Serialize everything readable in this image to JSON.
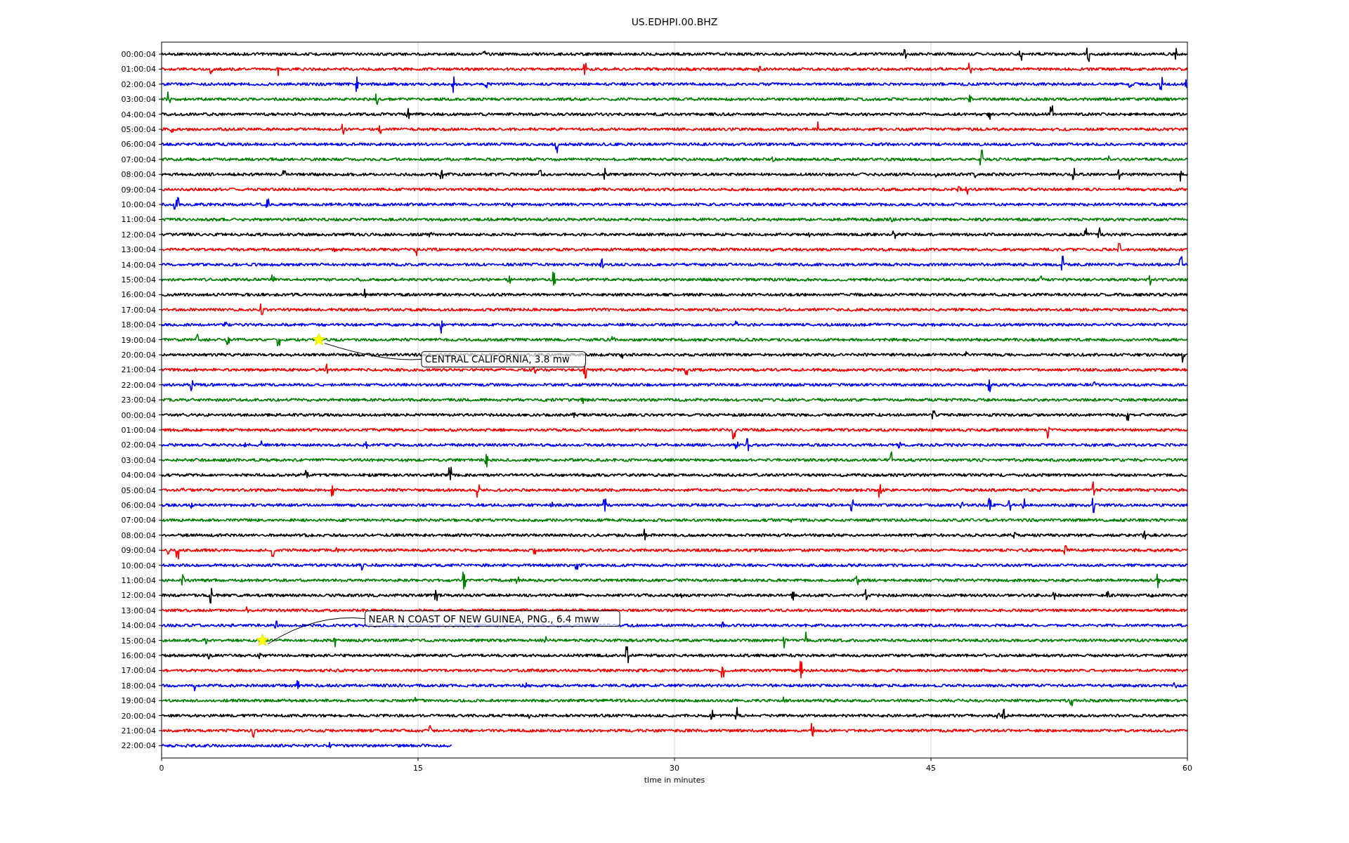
{
  "title": "US.EDHPI.00.BHZ",
  "traces": [
    {
      "label": "00:00:04",
      "color": "#000000",
      "level": 1
    },
    {
      "label": "01:00:04",
      "color": "#ff0000",
      "level": 1
    },
    {
      "label": "02:00:04",
      "color": "#0000ff",
      "level": 1
    },
    {
      "label": "03:00:04",
      "color": "#008000",
      "level": 1
    },
    {
      "label": "04:00:04",
      "color": "#000000",
      "level": 1
    },
    {
      "label": "05:00:04",
      "color": "#ff0000",
      "level": 1
    },
    {
      "label": "06:00:04",
      "color": "#0000ff",
      "level": 1
    },
    {
      "label": "07:00:04",
      "color": "#008000",
      "level": 1
    },
    {
      "label": "08:00:04",
      "color": "#000000",
      "level": 1
    },
    {
      "label": "09:00:04",
      "color": "#ff0000",
      "level": 1
    },
    {
      "label": "10:00:04",
      "color": "#0000ff",
      "level": 1
    },
    {
      "label": "11:00:04",
      "color": "#008000",
      "level": 1
    },
    {
      "label": "12:00:04",
      "color": "#000000",
      "level": 1
    },
    {
      "label": "13:00:04",
      "color": "#ff0000",
      "level": 1
    },
    {
      "label": "14:00:04",
      "color": "#0000ff",
      "level": 1
    },
    {
      "label": "15:00:04",
      "color": "#008000",
      "level": 1
    },
    {
      "label": "16:00:04",
      "color": "#000000",
      "level": 1
    },
    {
      "label": "17:00:04",
      "color": "#ff0000",
      "level": 1
    },
    {
      "label": "18:00:04",
      "color": "#0000ff",
      "level": 1
    },
    {
      "label": "19:00:04",
      "color": "#008000",
      "level": 1
    },
    {
      "label": "20:00:04",
      "color": "#000000",
      "level": 1
    },
    {
      "label": "21:00:04",
      "color": "#ff0000",
      "level": 1
    },
    {
      "label": "22:00:04",
      "color": "#0000ff",
      "level": 1
    },
    {
      "label": "23:00:04",
      "color": "#008000",
      "level": 1
    },
    {
      "label": "00:00:04",
      "color": "#000000",
      "level": 1
    },
    {
      "label": "01:00:04",
      "color": "#ff0000",
      "level": 1
    },
    {
      "label": "02:00:04",
      "color": "#0000ff",
      "level": 1
    },
    {
      "label": "03:00:04",
      "color": "#008000",
      "level": 1
    },
    {
      "label": "04:00:04",
      "color": "#000000",
      "level": 1
    },
    {
      "label": "05:00:04",
      "color": "#ff0000",
      "level": 1
    },
    {
      "label": "06:00:04",
      "color": "#0000ff",
      "level": 1
    },
    {
      "label": "07:00:04",
      "color": "#008000",
      "level": 1
    },
    {
      "label": "08:00:04",
      "color": "#000000",
      "level": 1
    },
    {
      "label": "09:00:04",
      "color": "#ff0000",
      "level": 1
    },
    {
      "label": "10:00:04",
      "color": "#0000ff",
      "level": 1
    },
    {
      "label": "11:00:04",
      "color": "#008000",
      "level": 1
    },
    {
      "label": "12:00:04",
      "color": "#000000",
      "level": 1
    },
    {
      "label": "13:00:04",
      "color": "#ff0000",
      "level": 1
    },
    {
      "label": "14:00:04",
      "color": "#0000ff",
      "level": 1
    },
    {
      "label": "15:00:04",
      "color": "#008000",
      "level": 1
    },
    {
      "label": "16:00:04",
      "color": "#000000",
      "level": 1
    },
    {
      "label": "17:00:04",
      "color": "#ff0000",
      "level": 1
    },
    {
      "label": "18:00:04",
      "color": "#0000ff",
      "level": 1
    },
    {
      "label": "19:00:04",
      "color": "#008000",
      "level": 1
    },
    {
      "label": "20:00:04",
      "color": "#000000",
      "level": 1
    },
    {
      "label": "21:00:04",
      "color": "#ff0000",
      "level": 1
    },
    {
      "label": "22:00:04",
      "color": "#0000ff",
      "level": 0.283
    }
  ],
  "annotations": [
    {
      "text": "CENTRAL CALIFORNIA, 3.8 mw"
    },
    {
      "text": "NEAR N COAST OF NEW GUINEA, PNG., 6.4 mww"
    }
  ],
  "xticks": [
    "0",
    "15",
    "30",
    "45",
    "60"
  ],
  "xlabel": "time in minutes"
}
